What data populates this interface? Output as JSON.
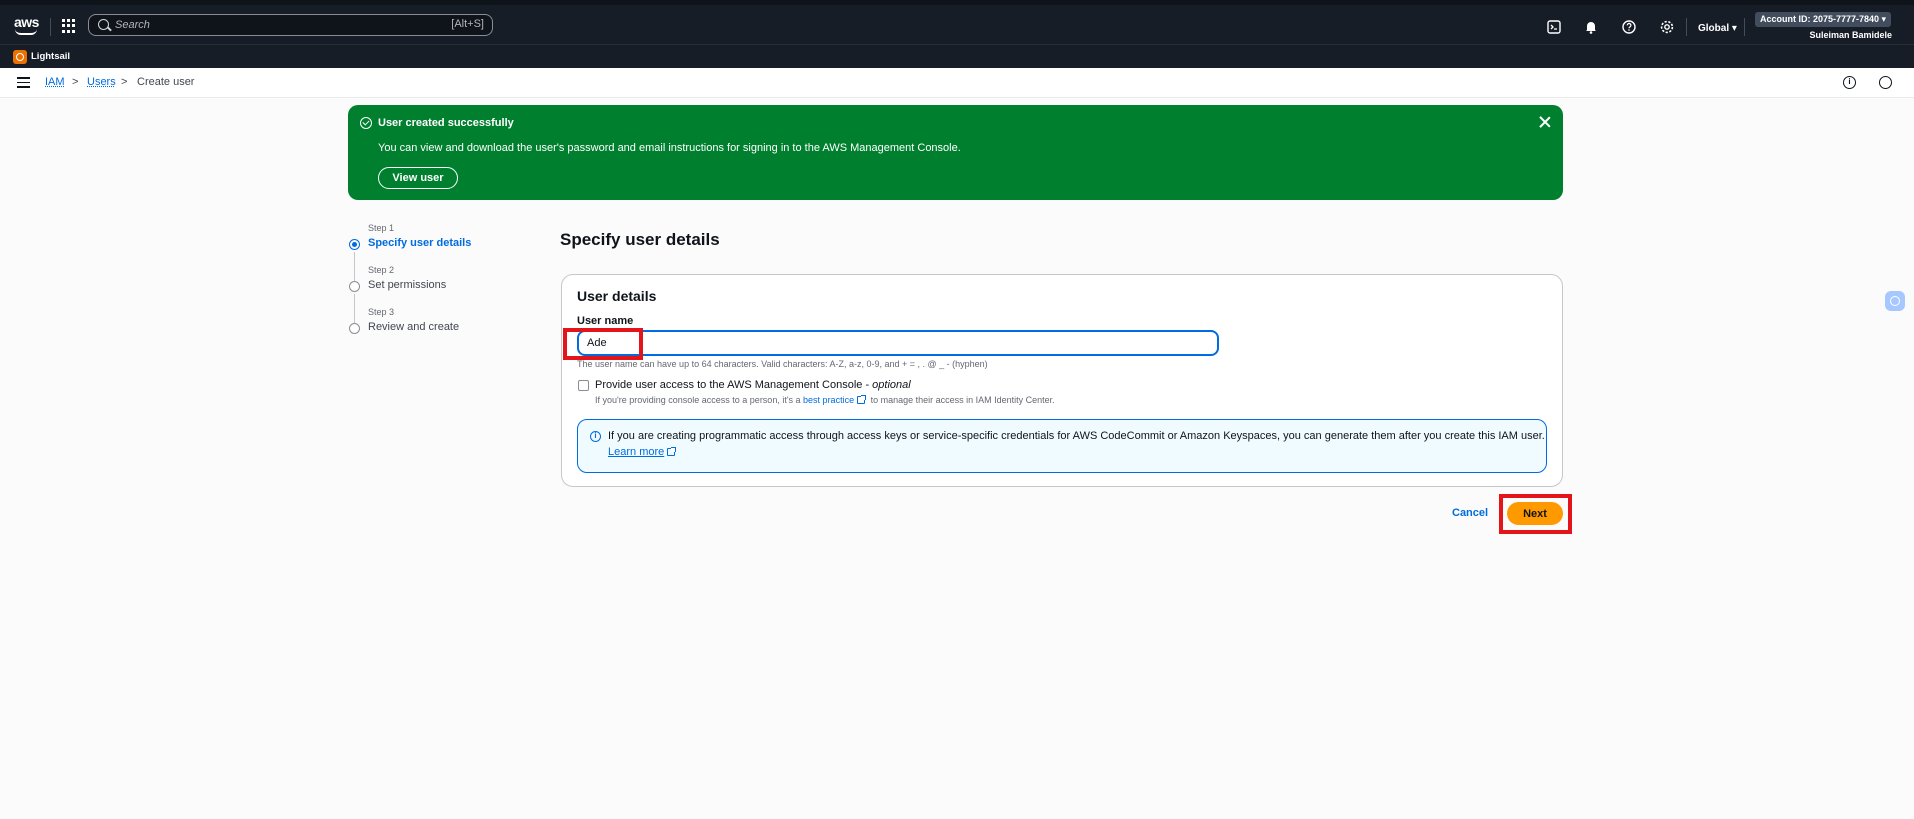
{
  "topnav": {
    "logo_text": "aws",
    "search_placeholder": "Search",
    "search_shortcut": "[Alt+S]",
    "region": "Global ▾",
    "account": "Account ID: 2075-7777-7840 ▾",
    "user": "Suleiman Bamidele"
  },
  "secondary": {
    "favorite": "Lightsail"
  },
  "breadcrumb": {
    "items": [
      "IAM",
      "Users"
    ],
    "current": "Create user",
    "separator": ">"
  },
  "flash": {
    "title": "User created successfully",
    "message": "You can view and download the user's password and email instructions for signing in to the AWS Management Console.",
    "button": "View user"
  },
  "steps": [
    {
      "label": "Step 1",
      "title": "Specify user details",
      "active": true
    },
    {
      "label": "Step 2",
      "title": "Set permissions",
      "active": false
    },
    {
      "label": "Step 3",
      "title": "Review and create",
      "active": false
    }
  ],
  "form": {
    "heading": "Specify user details",
    "panel_title": "User details",
    "username_label": "User name",
    "username_value": "Ade",
    "username_constraint": "The user name can have up to 64 characters. Valid characters: A-Z, a-z, 0-9, and + = , . @ _ - (hyphen)",
    "console_access_label": "Provide user access to the AWS Management Console - ",
    "console_access_optional": "optional",
    "console_access_desc_before": "If you're providing console access to a person, it's a ",
    "console_access_desc_link": "best practice",
    "console_access_desc_after": " to manage their access in IAM Identity Center.",
    "info_text": "If you are creating programmatic access through access keys or service-specific credentials for AWS CodeCommit or Amazon Keyspaces, you can generate them after you create this IAM user.",
    "info_link": "Learn more"
  },
  "actions": {
    "cancel": "Cancel",
    "next": "Next"
  },
  "colors": {
    "nav_bg": "#161d26",
    "success_green": "#00802f",
    "link_blue": "#006ce0",
    "primary_orange": "#ff9900",
    "highlight_red": "#e3151a"
  }
}
